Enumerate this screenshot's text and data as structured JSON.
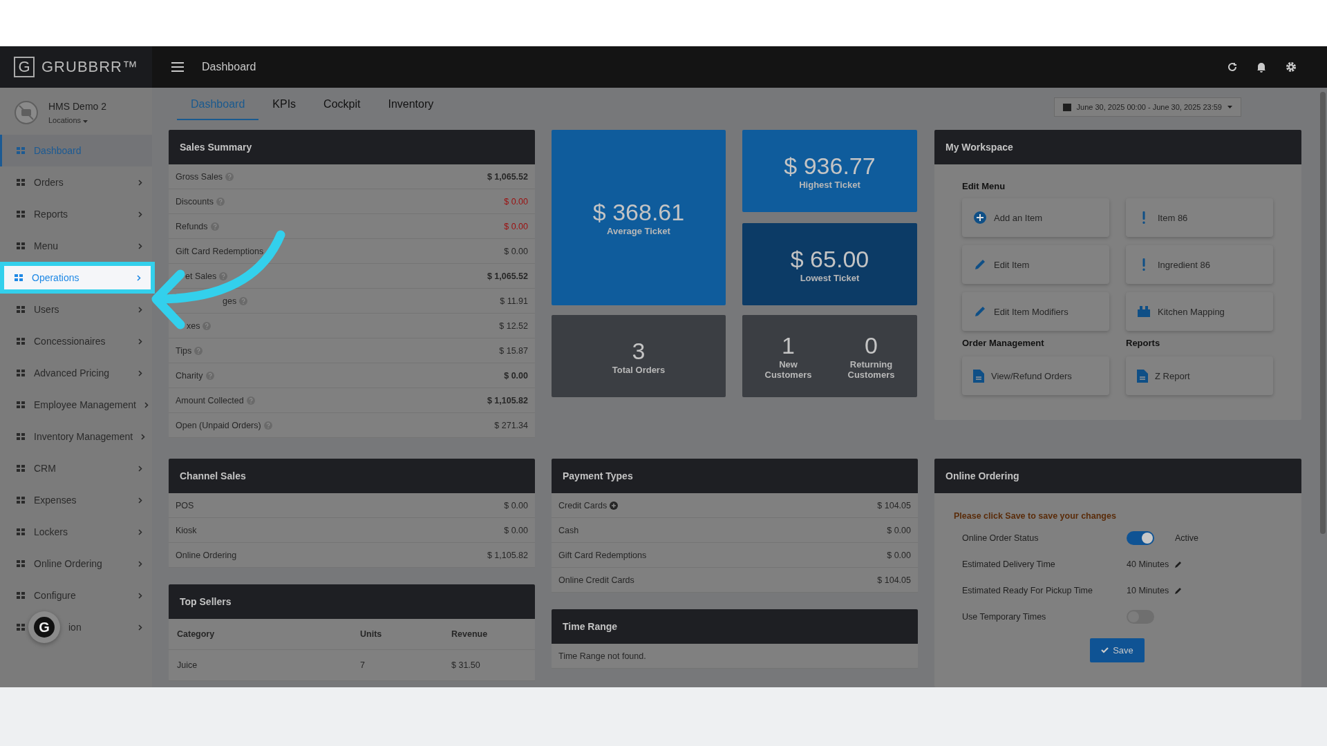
{
  "app": {
    "logo_letter": "G",
    "brand": "GRUBBRR™",
    "page_title": "Dashboard"
  },
  "account": {
    "name": "HMS Demo 2",
    "locations": "Locations"
  },
  "sidebar": {
    "items": [
      {
        "label": "Dashboard",
        "selected": true,
        "spotlight": false,
        "arrow": false
      },
      {
        "label": "Orders",
        "selected": false,
        "spotlight": false,
        "arrow": true
      },
      {
        "label": "Reports",
        "selected": false,
        "spotlight": false,
        "arrow": true
      },
      {
        "label": "Menu",
        "selected": false,
        "spotlight": false,
        "arrow": true
      },
      {
        "label": "Operations",
        "selected": false,
        "spotlight": true,
        "arrow": true
      },
      {
        "label": "Users",
        "selected": false,
        "spotlight": false,
        "arrow": true
      },
      {
        "label": "Concessionaires",
        "selected": false,
        "spotlight": false,
        "arrow": true
      },
      {
        "label": "Advanced Pricing",
        "selected": false,
        "spotlight": false,
        "arrow": true
      },
      {
        "label": "Employee Management",
        "selected": false,
        "spotlight": false,
        "arrow": true
      },
      {
        "label": "Inventory Management",
        "selected": false,
        "spotlight": false,
        "arrow": true
      },
      {
        "label": "CRM",
        "selected": false,
        "spotlight": false,
        "arrow": true
      },
      {
        "label": "Expenses",
        "selected": false,
        "spotlight": false,
        "arrow": true
      },
      {
        "label": "Lockers",
        "selected": false,
        "spotlight": false,
        "arrow": true
      },
      {
        "label": "Online Ordering",
        "selected": false,
        "spotlight": false,
        "arrow": true
      },
      {
        "label": "Configure",
        "selected": false,
        "spotlight": false,
        "arrow": true
      },
      {
        "label": "ion",
        "selected": false,
        "spotlight": false,
        "arrow": true
      }
    ]
  },
  "assistant_button": {
    "label": "G"
  },
  "tabs": [
    {
      "label": "Dashboard",
      "selected": true
    },
    {
      "label": "KPIs",
      "selected": false
    },
    {
      "label": "Cockpit",
      "selected": false
    },
    {
      "label": "Inventory",
      "selected": false
    }
  ],
  "date_range": "June 30, 2025 00:00 - June 30, 2025 23:59",
  "sales_summary": {
    "title": "Sales Summary",
    "rows": [
      {
        "label": "Gross Sales",
        "value": "$ 1,065.52",
        "bold": true,
        "negative": false,
        "help": true
      },
      {
        "label": "Discounts",
        "value": "$ 0.00",
        "bold": false,
        "negative": true,
        "help": true
      },
      {
        "label": "Refunds",
        "value": "$ 0.00",
        "bold": false,
        "negative": true,
        "help": true
      },
      {
        "label": "Gift Card Redemptions",
        "value": "$ 0.00",
        "bold": false,
        "negative": false,
        "help": false
      },
      {
        "label": "et Sales",
        "value": "$ 1,065.52",
        "bold": true,
        "negative": false,
        "help": true
      },
      {
        "label": "ges",
        "value": "$ 11.91",
        "bold": false,
        "negative": false,
        "help": true
      },
      {
        "label": "xes",
        "value": "$ 12.52",
        "bold": false,
        "negative": false,
        "help": true
      },
      {
        "label": "Tips",
        "value": "$ 15.87",
        "bold": false,
        "negative": false,
        "help": true
      },
      {
        "label": "Charity",
        "value": "$ 0.00",
        "bold": true,
        "negative": false,
        "help": true
      },
      {
        "label": "Amount Collected",
        "value": "$ 1,105.82",
        "bold": true,
        "negative": false,
        "help": true
      },
      {
        "label": "Open (Unpaid Orders)",
        "value": "$ 271.34",
        "bold": false,
        "negative": false,
        "help": true
      }
    ]
  },
  "tiles": {
    "average": {
      "value": "$ 368.61",
      "label": "Average Ticket"
    },
    "highest": {
      "value": "$ 936.77",
      "label": "Highest Ticket"
    },
    "lowest": {
      "value": "$ 65.00",
      "label": "Lowest Ticket"
    },
    "total_orders": {
      "value": "3",
      "label": "Total Orders"
    },
    "customers": [
      {
        "value": "1",
        "label": "New Customers"
      },
      {
        "value": "0",
        "label": "Returning Customers"
      }
    ]
  },
  "workspace": {
    "title": "My Workspace",
    "sections": [
      {
        "title": "Edit Menu",
        "buttons": [
          "Add an Item",
          "Item 86",
          "Edit Item",
          "Ingredient 86",
          "Edit Item Modifiers",
          "Kitchen Mapping"
        ]
      }
    ],
    "order_management": {
      "title": "Order Management",
      "button": "View/Refund Orders"
    },
    "reports": {
      "title": "Reports",
      "button": "Z Report"
    }
  },
  "channel_sales": {
    "title": "Channel Sales",
    "rows": [
      {
        "label": "POS",
        "value": "$ 0.00"
      },
      {
        "label": "Kiosk",
        "value": "$ 0.00"
      },
      {
        "label": "Online Ordering",
        "value": "$ 1,105.82"
      }
    ]
  },
  "payment_types": {
    "title": "Payment Types",
    "rows": [
      {
        "label": "Credit Cards",
        "value": "$ 104.05",
        "expandable": true
      },
      {
        "label": "Cash",
        "value": "$ 0.00",
        "expandable": false
      },
      {
        "label": "Gift Card Redemptions",
        "value": "$ 0.00",
        "expandable": false
      },
      {
        "label": "Online Credit Cards",
        "value": "$ 104.05",
        "expandable": false
      }
    ]
  },
  "top_sellers": {
    "title": "Top Sellers",
    "columns": [
      "Category",
      "Units",
      "Revenue"
    ],
    "rows": [
      [
        "Juice",
        "7",
        "$ 31.50"
      ]
    ]
  },
  "time_range": {
    "title": "Time Range",
    "message": "Time Range not found."
  },
  "online_ordering": {
    "title": "Online Ordering",
    "notice": "Please click Save to save your changes",
    "status": {
      "label": "Online Order Status",
      "on": true,
      "state": "Active"
    },
    "delivery": {
      "label": "Estimated Delivery Time",
      "value": "40 Minutes"
    },
    "pickup": {
      "label": "Estimated Ready For Pickup Time",
      "value": "10 Minutes"
    },
    "temporary": {
      "label": "Use Temporary Times",
      "on": false
    },
    "save": "Save"
  }
}
